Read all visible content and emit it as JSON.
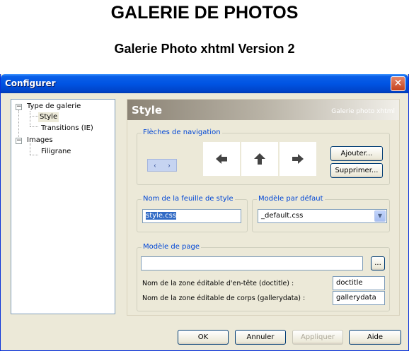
{
  "page": {
    "heading": "GALERIE DE PHOTOS",
    "subheading": "Galerie Photo xhtml Version 2"
  },
  "window": {
    "title": "Configurer",
    "close_glyph": "✕"
  },
  "tree": {
    "items": [
      {
        "label": "Type de galerie",
        "level": 0,
        "expander": "−"
      },
      {
        "label": "Style",
        "level": 1,
        "selected": true
      },
      {
        "label": "Transitions (IE)",
        "level": 1
      },
      {
        "label": "Images",
        "level": 0,
        "expander": "−"
      },
      {
        "label": "Filigrane",
        "level": 1
      }
    ]
  },
  "panel": {
    "title": "Style",
    "subtitle": "Galerie photo xhtml"
  },
  "nav_arrows": {
    "legend": "Flèches de navigation",
    "sample_left": "‹",
    "sample_right": "›",
    "icons": [
      "arrow-left-icon",
      "arrow-up-icon",
      "arrow-right-icon"
    ],
    "add_label": "Ajouter...",
    "remove_label": "Supprimer..."
  },
  "stylesheet": {
    "legend": "Nom de la feuille de style",
    "value": "style.css"
  },
  "default_model": {
    "legend": "Modèle par défaut",
    "value": "_default.css"
  },
  "page_model": {
    "legend": "Modèle de page",
    "value": "",
    "browse_label": "...",
    "header_zone_label": "Nom de la zone éditable d'en-tête (doctitle) :",
    "header_zone_value": "doctitle",
    "body_zone_label": "Nom de la zone éditable de corps (gallerydata) :",
    "body_zone_value": "gallerydata"
  },
  "buttons": {
    "ok": "OK",
    "cancel": "Annuler",
    "apply": "Appliquer",
    "help": "Aide"
  }
}
